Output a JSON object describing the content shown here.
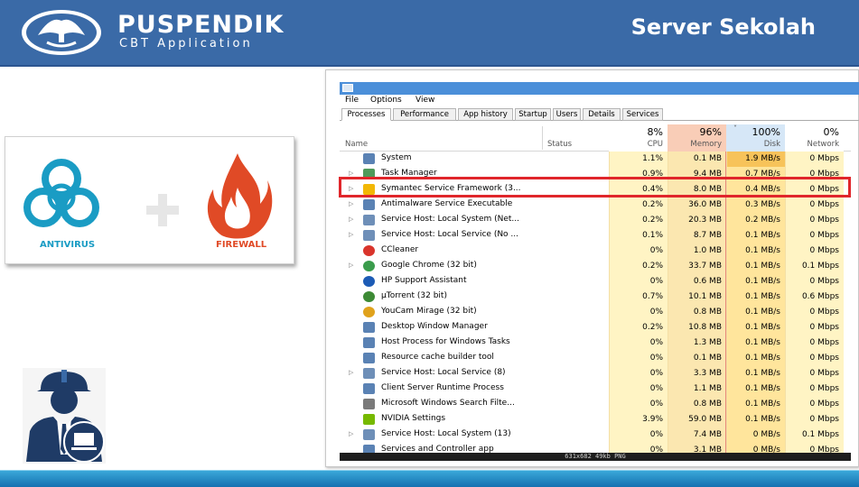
{
  "header": {
    "brand_name": "PUSPENDIK",
    "brand_sub": "CBT Application",
    "slide_title": "Server Sekolah"
  },
  "card": {
    "antivirus_label": "ANTIVIRUS",
    "firewall_label": "FIREWALL"
  },
  "colors": {
    "header_bg": "#3a6aa7",
    "antivirus": "#1a9cc4",
    "firewall": "#e04a26",
    "highlight": "#e0262b",
    "cpu_bg": "#fff4c4",
    "memory_bg": "#fbe7b0",
    "disk_bg": "#ffe59c"
  },
  "task_manager": {
    "menu": [
      "File",
      "Options",
      "View"
    ],
    "tabs": [
      "Processes",
      "Performance",
      "App history",
      "Startup",
      "Users",
      "Details",
      "Services"
    ],
    "active_tab": "Processes",
    "columns": {
      "name": "Name",
      "status": "Status",
      "cpu": {
        "pct": "8%",
        "label": "CPU"
      },
      "memory": {
        "pct": "96%",
        "label": "Memory"
      },
      "disk": {
        "pct": "100%",
        "label": "Disk"
      },
      "network": {
        "pct": "0%",
        "label": "Network"
      }
    },
    "rows": [
      {
        "name": "System",
        "expandable": false,
        "icon": "window-icon",
        "cpu": "1.1%",
        "memory": "0.1 MB",
        "disk": "1.9 MB/s",
        "network": "0 Mbps"
      },
      {
        "name": "Task Manager",
        "expandable": true,
        "icon": "task-manager-icon",
        "cpu": "0.9%",
        "memory": "9.4 MB",
        "disk": "0.7 MB/s",
        "network": "0 Mbps"
      },
      {
        "name": "Symantec Service Framework (3...",
        "expandable": true,
        "icon": "symantec-icon",
        "cpu": "0.4%",
        "memory": "8.0 MB",
        "disk": "0.4 MB/s",
        "network": "0 Mbps"
      },
      {
        "name": "Antimalware Service Executable",
        "expandable": true,
        "icon": "window-icon",
        "cpu": "0.2%",
        "memory": "36.0 MB",
        "disk": "0.3 MB/s",
        "network": "0 Mbps"
      },
      {
        "name": "Service Host: Local System (Net...",
        "expandable": true,
        "icon": "gear-icon",
        "cpu": "0.2%",
        "memory": "20.3 MB",
        "disk": "0.2 MB/s",
        "network": "0 Mbps"
      },
      {
        "name": "Service Host: Local Service (No ...",
        "expandable": true,
        "icon": "gear-icon",
        "cpu": "0.1%",
        "memory": "8.7 MB",
        "disk": "0.1 MB/s",
        "network": "0 Mbps"
      },
      {
        "name": "CCleaner",
        "expandable": false,
        "icon": "ccleaner-icon",
        "cpu": "0%",
        "memory": "1.0 MB",
        "disk": "0.1 MB/s",
        "network": "0 Mbps"
      },
      {
        "name": "Google Chrome (32 bit)",
        "expandable": true,
        "icon": "chrome-icon",
        "cpu": "0.2%",
        "memory": "33.7 MB",
        "disk": "0.1 MB/s",
        "network": "0.1 Mbps"
      },
      {
        "name": "HP Support Assistant",
        "expandable": false,
        "icon": "help-icon",
        "cpu": "0%",
        "memory": "0.6 MB",
        "disk": "0.1 MB/s",
        "network": "0 Mbps"
      },
      {
        "name": "µTorrent (32 bit)",
        "expandable": false,
        "icon": "utorrent-icon",
        "cpu": "0.7%",
        "memory": "10.1 MB",
        "disk": "0.1 MB/s",
        "network": "0.6 Mbps"
      },
      {
        "name": "YouCam Mirage (32 bit)",
        "expandable": false,
        "icon": "camera-icon",
        "cpu": "0%",
        "memory": "0.8 MB",
        "disk": "0.1 MB/s",
        "network": "0 Mbps"
      },
      {
        "name": "Desktop Window Manager",
        "expandable": false,
        "icon": "window-icon",
        "cpu": "0.2%",
        "memory": "10.8 MB",
        "disk": "0.1 MB/s",
        "network": "0 Mbps"
      },
      {
        "name": "Host Process for Windows Tasks",
        "expandable": false,
        "icon": "window-icon",
        "cpu": "0%",
        "memory": "1.3 MB",
        "disk": "0.1 MB/s",
        "network": "0 Mbps"
      },
      {
        "name": "Resource cache builder tool",
        "expandable": false,
        "icon": "window-icon",
        "cpu": "0%",
        "memory": "0.1 MB",
        "disk": "0.1 MB/s",
        "network": "0 Mbps"
      },
      {
        "name": "Service Host: Local Service (8)",
        "expandable": true,
        "icon": "gear-icon",
        "cpu": "0%",
        "memory": "3.3 MB",
        "disk": "0.1 MB/s",
        "network": "0 Mbps"
      },
      {
        "name": "Client Server Runtime Process",
        "expandable": false,
        "icon": "window-icon",
        "cpu": "0%",
        "memory": "1.1 MB",
        "disk": "0.1 MB/s",
        "network": "0 Mbps"
      },
      {
        "name": "Microsoft Windows Search Filte...",
        "expandable": false,
        "icon": "search-icon",
        "cpu": "0%",
        "memory": "0.8 MB",
        "disk": "0.1 MB/s",
        "network": "0 Mbps"
      },
      {
        "name": "NVIDIA Settings",
        "expandable": false,
        "icon": "nvidia-icon",
        "cpu": "3.9%",
        "memory": "59.0 MB",
        "disk": "0.1 MB/s",
        "network": "0 Mbps"
      },
      {
        "name": "Service Host: Local System (13)",
        "expandable": true,
        "icon": "gear-icon",
        "cpu": "0%",
        "memory": "7.4 MB",
        "disk": "0 MB/s",
        "network": "0.1 Mbps"
      },
      {
        "name": "Services and Controller app",
        "expandable": false,
        "icon": "window-icon",
        "cpu": "0%",
        "memory": "3.1 MB",
        "disk": "0 MB/s",
        "network": "0 Mbps"
      }
    ],
    "highlighted_row": 2,
    "image_caption": "631x682  49kb  PNG"
  }
}
